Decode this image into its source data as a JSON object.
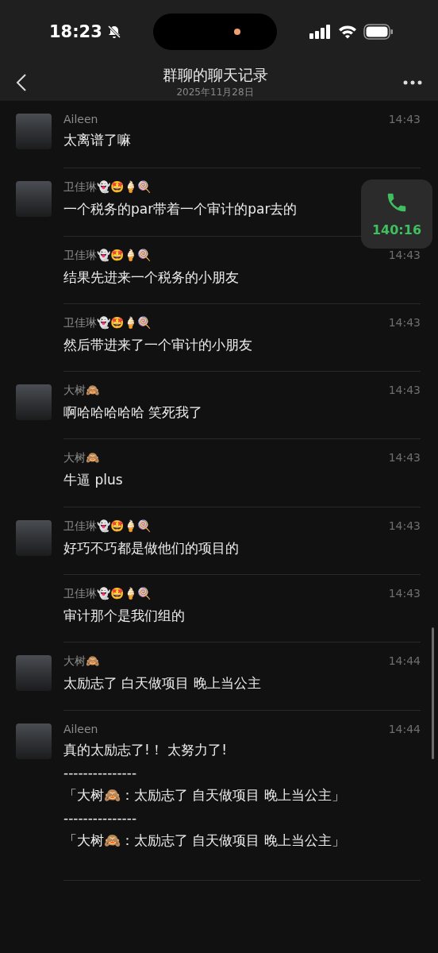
{
  "status_bar": {
    "time": "18:23"
  },
  "nav": {
    "title": "群聊的聊天记录",
    "subtitle": "2025年11月28日"
  },
  "call_widget": {
    "duration": "140:16"
  },
  "messages": [
    {
      "sender": "Aileen",
      "show_avatar": true,
      "time": "14:43",
      "lines": [
        "太离谱了嘛"
      ]
    },
    {
      "sender": "卫佳琳👻🤩🍦🍭",
      "show_avatar": true,
      "lines": [
        "一个税务的par带着一个审计的par去的"
      ]
    },
    {
      "sender": "卫佳琳👻🤩🍦🍭",
      "show_avatar": false,
      "time": "14:43",
      "lines": [
        "结果先进来一个税务的小朋友"
      ]
    },
    {
      "sender": "卫佳琳👻🤩🍦🍭",
      "show_avatar": false,
      "time": "14:43",
      "lines": [
        "然后带进来了一个审计的小朋友"
      ]
    },
    {
      "sender": "大树🙈",
      "show_avatar": true,
      "time": "14:43",
      "lines": [
        "啊哈哈哈哈哈 笑死我了"
      ]
    },
    {
      "sender": "大树🙈",
      "show_avatar": false,
      "time": "14:43",
      "lines": [
        "牛逼 plus"
      ]
    },
    {
      "sender": "卫佳琳👻🤩🍦🍭",
      "show_avatar": true,
      "time": "14:43",
      "lines": [
        "好巧不巧都是做他们的项目的"
      ]
    },
    {
      "sender": "卫佳琳👻🤩🍦🍭",
      "show_avatar": false,
      "time": "14:43",
      "lines": [
        "审计那个是我们组的"
      ]
    },
    {
      "sender": "大树🙈",
      "show_avatar": true,
      "time": "14:44",
      "lines": [
        "太励志了 白天做项目 晚上当公主"
      ]
    },
    {
      "sender": "Aileen",
      "show_avatar": true,
      "time": "14:44",
      "lines": [
        "真的太励志了!！ 太努力了!",
        "---------------",
        "「大树🙈：太励志了 自天做项目 晚上当公主」",
        "---------------",
        "「大树🙈：太励志了 自天做项目 晚上当公主」"
      ]
    }
  ]
}
